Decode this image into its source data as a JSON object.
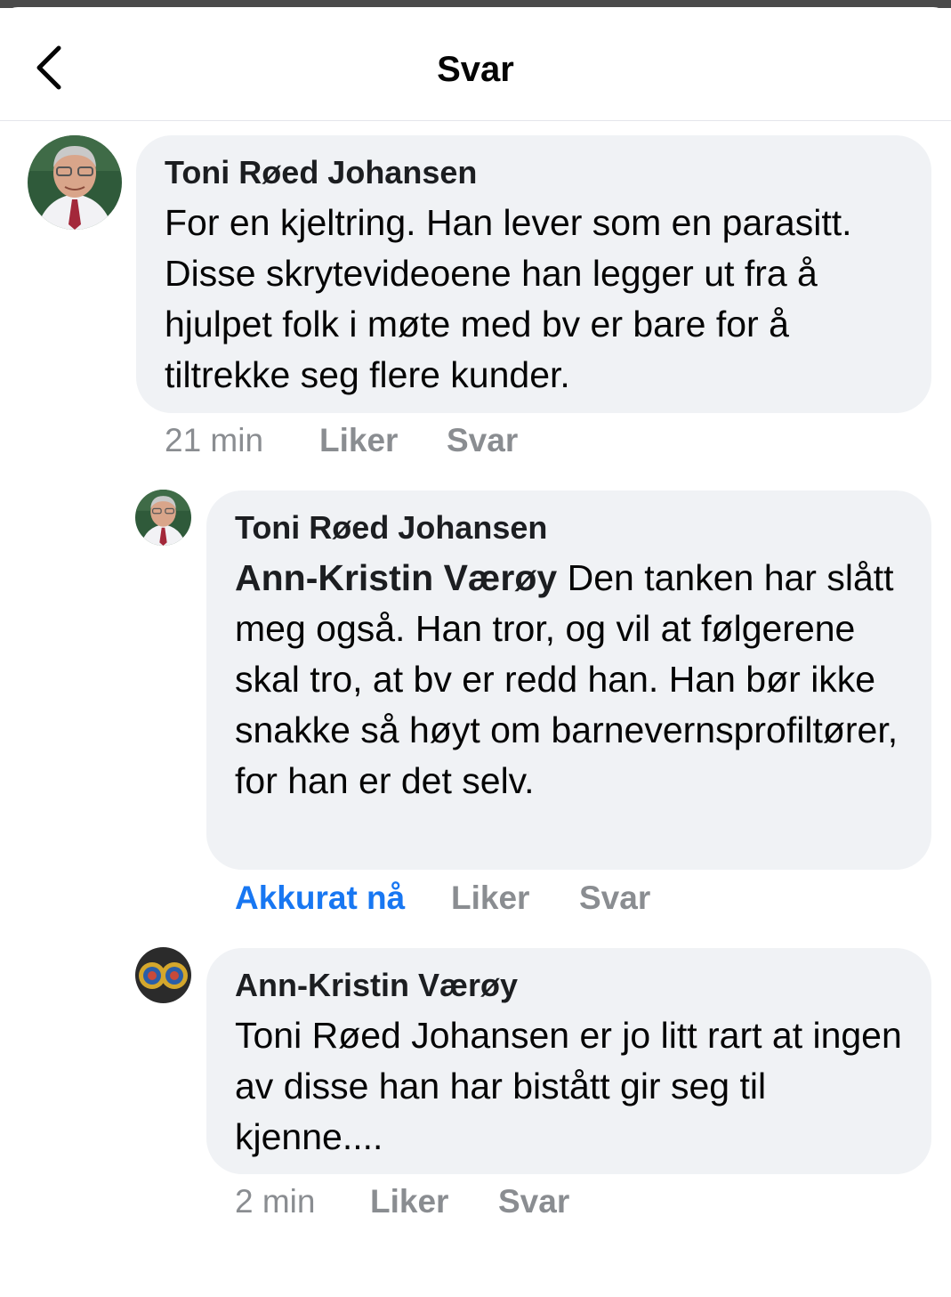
{
  "header": {
    "title": "Svar"
  },
  "comments": [
    {
      "author": "Toni Røed Johansen",
      "mention": "",
      "text": "For en kjeltring. Han lever som en parasitt. Disse skrytevideoene han legger ut fra å hjulpet folk i møte med bv er bare for å tiltrekke seg flere kunder.",
      "timestamp": "21 min",
      "like_label": "Liker",
      "reply_label": "Svar"
    },
    {
      "author": "Toni Røed Johansen",
      "mention": "Ann-Kristin Værøy",
      "text": " Den tanken har slått meg også. Han tror, og vil at følgerene skal tro, at bv er redd han. Han bør ikke snakke så høyt om barnevernsprofiltører, for han er det selv.",
      "timestamp": "Akkurat nå",
      "like_label": "Liker",
      "reply_label": "Svar"
    },
    {
      "author": "Ann-Kristin Værøy",
      "mention": "",
      "text": "Toni Røed Johansen er jo litt rart at ingen av disse han har bistått gir seg til kjenne....",
      "timestamp": "2 min",
      "like_label": "Liker",
      "reply_label": "Svar"
    }
  ],
  "colors": {
    "bubble_bg": "#f0f2f5",
    "meta_gray": "#8a8d91",
    "link_blue": "#1877f2",
    "text": "#050505"
  },
  "icons": {
    "back": "chevron-left-icon"
  }
}
